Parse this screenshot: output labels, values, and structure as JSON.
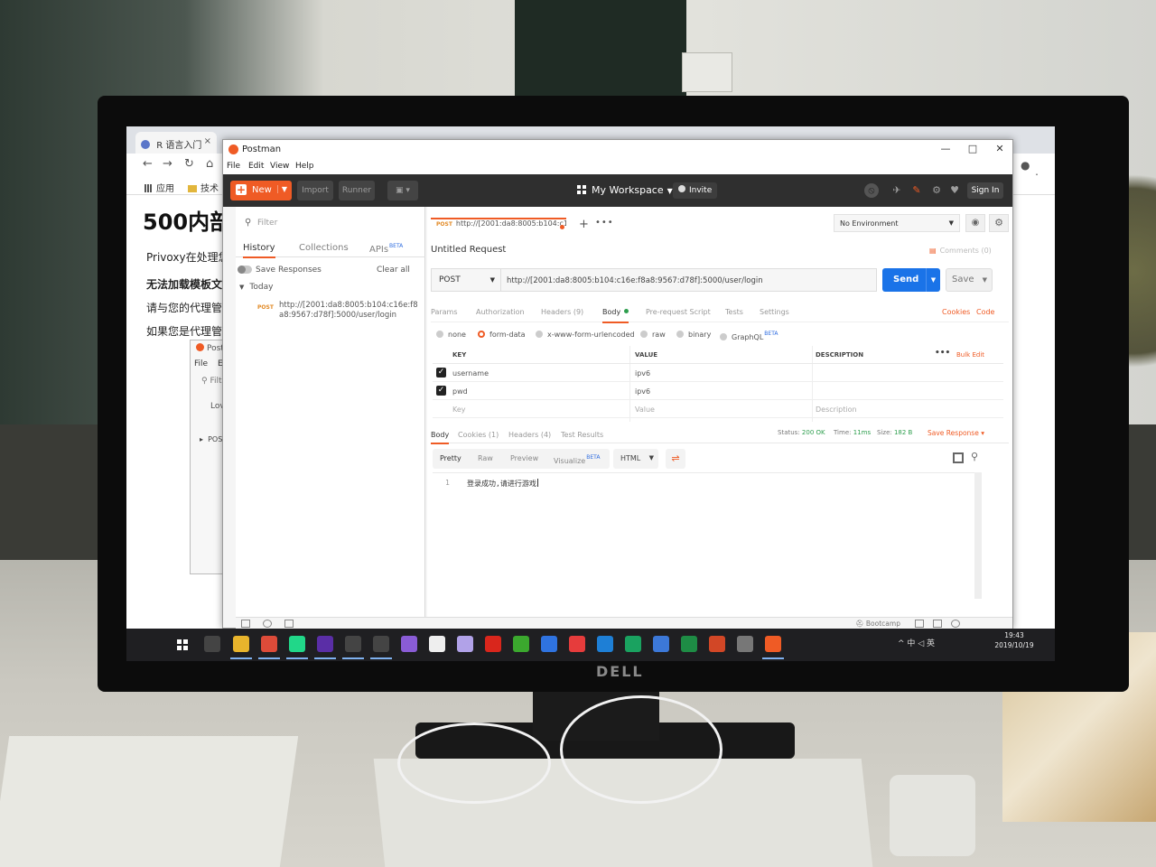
{
  "browser": {
    "tab_title": "R 语言入门",
    "tab_close": "×",
    "bookmarks": [
      "应用",
      "技术"
    ],
    "page": {
      "title": "500内部",
      "lines": [
        "Privoxy在处理您",
        "无法加载模板文件",
        "请与您的代理管理",
        "如果您是代理管理"
      ]
    }
  },
  "ghost_window": {
    "title": "Postman",
    "menu": [
      "File",
      "Edit"
    ],
    "filter": "Filte",
    "love": "Love",
    "post": "POST"
  },
  "postman": {
    "window_title": "Postman",
    "window_controls": [
      "—",
      "□",
      "✕"
    ],
    "menu": [
      "File",
      "Edit",
      "View",
      "Help"
    ],
    "header": {
      "new_label": "New",
      "import_label": "Import",
      "runner_label": "Runner",
      "workspace_label": "My Workspace",
      "invite_label": "Invite",
      "signin_label": "Sign In"
    },
    "sidebar": {
      "filter_placeholder": "Filter",
      "tabs": [
        "History",
        "Collections",
        "APIs"
      ],
      "beta": "BETA",
      "save_responses": "Save Responses",
      "clear_all": "Clear all",
      "today": "Today",
      "history_items": [
        {
          "method": "POST",
          "url": "http://[2001:da8:8005:b104:c16e:f8a8:9567:d78f]:5000/user/login"
        }
      ]
    },
    "request": {
      "tab_method": "POST",
      "tab_title": "http://[2001:da8:8005:b104:c1...",
      "name": "Untitled Request",
      "comments": "Comments (0)",
      "environment": "No Environment",
      "method": "POST",
      "url": "http://[2001:da8:8005:b104:c16e:f8a8:9567:d78f]:5000/user/login",
      "send_label": "Send",
      "save_label": "Save",
      "tabs": [
        "Params",
        "Authorization",
        "Headers (9)",
        "Body",
        "Pre-request Script",
        "Tests",
        "Settings"
      ],
      "cookies_link": "Cookies",
      "code_link": "Code",
      "body_types": [
        "none",
        "form-data",
        "x-www-form-urlencoded",
        "raw",
        "binary",
        "GraphQL"
      ],
      "body_type_selected": "form-data",
      "graphql_beta": "BETA",
      "table_headers": [
        "KEY",
        "VALUE",
        "DESCRIPTION"
      ],
      "bulk_edit": "Bulk Edit",
      "more": "•••",
      "rows": [
        {
          "key": "username",
          "value": "ipv6",
          "checked": true
        },
        {
          "key": "pwd",
          "value": "ipv6",
          "checked": true
        }
      ],
      "placeholder_row": {
        "key": "Key",
        "value": "Value",
        "description": "Description"
      }
    },
    "response": {
      "tabs": [
        "Body",
        "Cookies (1)",
        "Headers (4)",
        "Test Results"
      ],
      "status_label": "Status:",
      "status_value": "200 OK",
      "time_label": "Time:",
      "time_value": "11ms",
      "size_label": "Size:",
      "size_value": "182 B",
      "save_response": "Save Response",
      "view_tabs": [
        "Pretty",
        "Raw",
        "Preview",
        "Visualize"
      ],
      "visualize_beta": "BETA",
      "format": "HTML",
      "line_number": "1",
      "body_text": "登录成功,请进行游戏"
    },
    "statusbar": {
      "bootcamp": "Bootcamp"
    }
  },
  "taskbar": {
    "tray_text": "^ 中 ◁ 英",
    "time": "19:43",
    "date": "2019/10/19",
    "icon_colors": [
      "#e8b42c",
      "#dd4b39",
      "#21d789",
      "#5a2ea6",
      "#444444",
      "#444444",
      "#8a5cd6",
      "#eeeeee",
      "#b1a2e8",
      "#d9261c",
      "#3ba82e",
      "#2f73e0",
      "#e63c3c",
      "#1e7fd6",
      "#1aa260",
      "#3c78d8",
      "#1e8c45",
      "#d24726",
      "#777777",
      "#ef5b25"
    ]
  }
}
